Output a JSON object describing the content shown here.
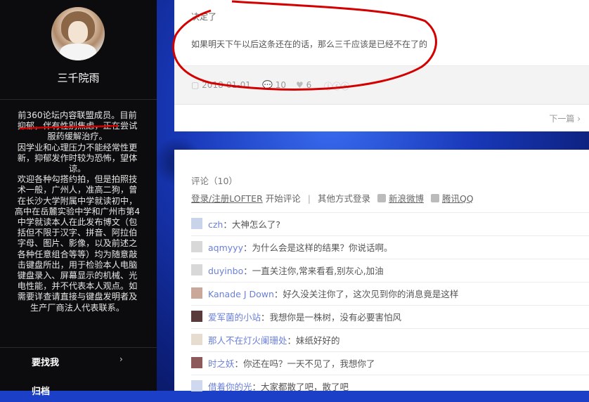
{
  "sidebar": {
    "name": "三千院雨",
    "bio": [
      "前360论坛内容联盟成员。目前抑郁，伴有性别焦虑，正在尝试服药缓解治疗。",
      "因学业和心理压力不能经常性更新，抑郁发作时较为恐怖，望体谅。",
      "欢迎各种勾搭约拍，但是拍照技术一般，广州人，准高二狗，曾在长沙大学附属中学就读初中，高中在岳麓实验中学和广州市第4中学就读本人在此发布博文（包括但不限于汉字、拼音、阿拉伯字母、图片、影像，以及前述之各种任意组合等等）均为随意敲击键盘所出，用于检验本人电脑键盘录入、屏幕显示的机械、光电性能，并不代表本人观点。如需要详查请直接与键盘发明者及生产厂商法人代表联系。"
    ],
    "nav": [
      {
        "label": "要找我",
        "arrow": "›"
      },
      {
        "label": "归档"
      }
    ]
  },
  "post": {
    "top_text": "决定了",
    "body": "如果明天下午以后这条还在的话，那么三千应该是已经不在了的",
    "date": "2018-01-01",
    "comment_count": "10",
    "like_count": "6",
    "next_label": "下一篇",
    "next_arrow": "›"
  },
  "comments": {
    "count_label": "评论（10）",
    "login": {
      "register": "登录/注册LOFTER",
      "start": "开始评论",
      "other": "其他方式登录",
      "weibo": "新浪微博",
      "qq": "腾讯QQ"
    },
    "items": [
      {
        "user": "czh",
        "text": "：大神怎么了?",
        "avatar_color": "#c9d3ea"
      },
      {
        "user": "aqmyyy",
        "text": "：为什么会是这样的结果？你说话啊。",
        "avatar_color": "#d8d8d8"
      },
      {
        "user": "duyinbo",
        "text": "：一直关注你,常来看看,别灰心,加油",
        "avatar_color": "#d8d8d8"
      },
      {
        "user": "Kanade J Down",
        "text": "：好久没关注你了，这次见到你的消息竟是这样",
        "avatar_color": "#c9a89a"
      },
      {
        "user": "爱军菌的小站",
        "text": "：我想你是一株树，没有必要害怕风",
        "avatar_color": "#5a3b3b"
      },
      {
        "user": "那人不在灯火阑珊处",
        "text": "：妹纸好好的",
        "avatar_color": "#e6dccf"
      },
      {
        "user": "时之妖",
        "text": "：你还在吗？一天不见了，我想你了",
        "avatar_color": "#8c5a5a"
      },
      {
        "user": "借着你的光",
        "text": "：大家都散了吧，散了吧",
        "avatar_color": "#cfd8ef"
      }
    ]
  },
  "colors": {
    "accent_link": "#6a7fd8",
    "annotation_red": "#d40000",
    "sidebar_bg": "#0c0c0e"
  }
}
